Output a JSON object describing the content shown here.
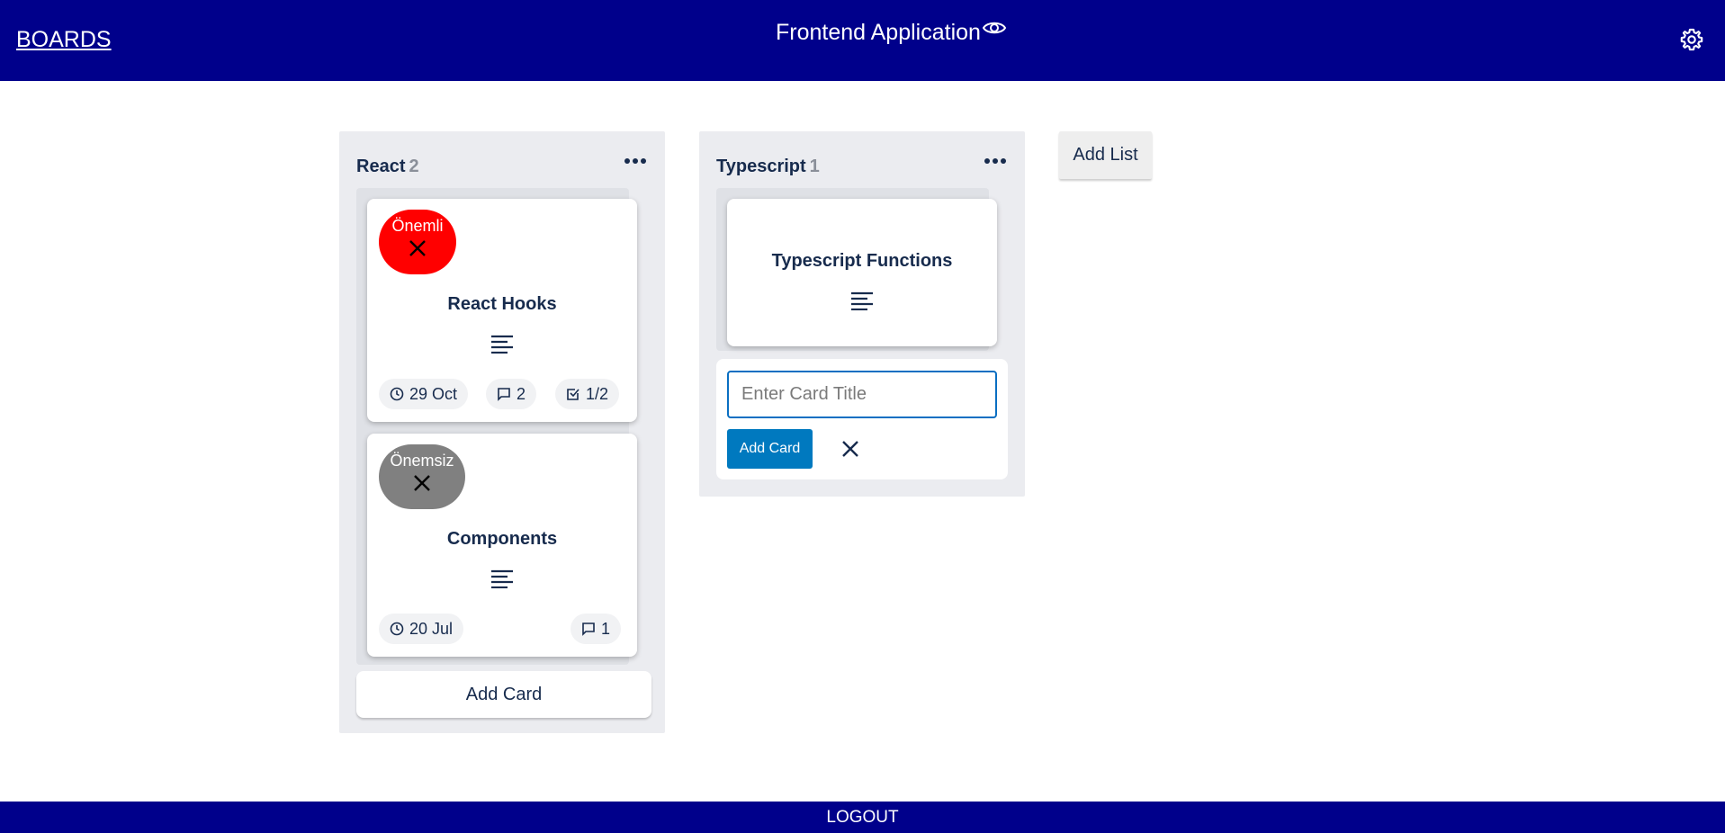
{
  "header": {
    "boards_label": "BOARDS",
    "title": "Frontend Application",
    "eye_icon": "eye-icon",
    "settings_icon": "gear-icon",
    "background": "#00008b"
  },
  "lists": [
    {
      "title": "React",
      "count": "2",
      "cards": [
        {
          "label": "Önemli",
          "label_color": "#ff0000",
          "title": "React Hooks",
          "due": "29 Oct",
          "comments": "2",
          "checklist": "1/2"
        },
        {
          "label": "Önemsiz",
          "label_color": "#808080",
          "title": "Components",
          "due": "20 Jul",
          "comments": "1"
        }
      ],
      "add_card_label": "Add Card"
    },
    {
      "title": "Typescript",
      "count": "1",
      "cards": [
        {
          "title": "Typescript Functions"
        }
      ],
      "composer": {
        "placeholder": "Enter Card Title",
        "value": "",
        "add_label": "Add Card"
      }
    }
  ],
  "add_list_label": "Add List",
  "footer": {
    "logout_label": "LOGOUT"
  },
  "colors": {
    "accent": "#0079bf",
    "list_bg": "#ebecf0",
    "text": "#172b4d"
  }
}
